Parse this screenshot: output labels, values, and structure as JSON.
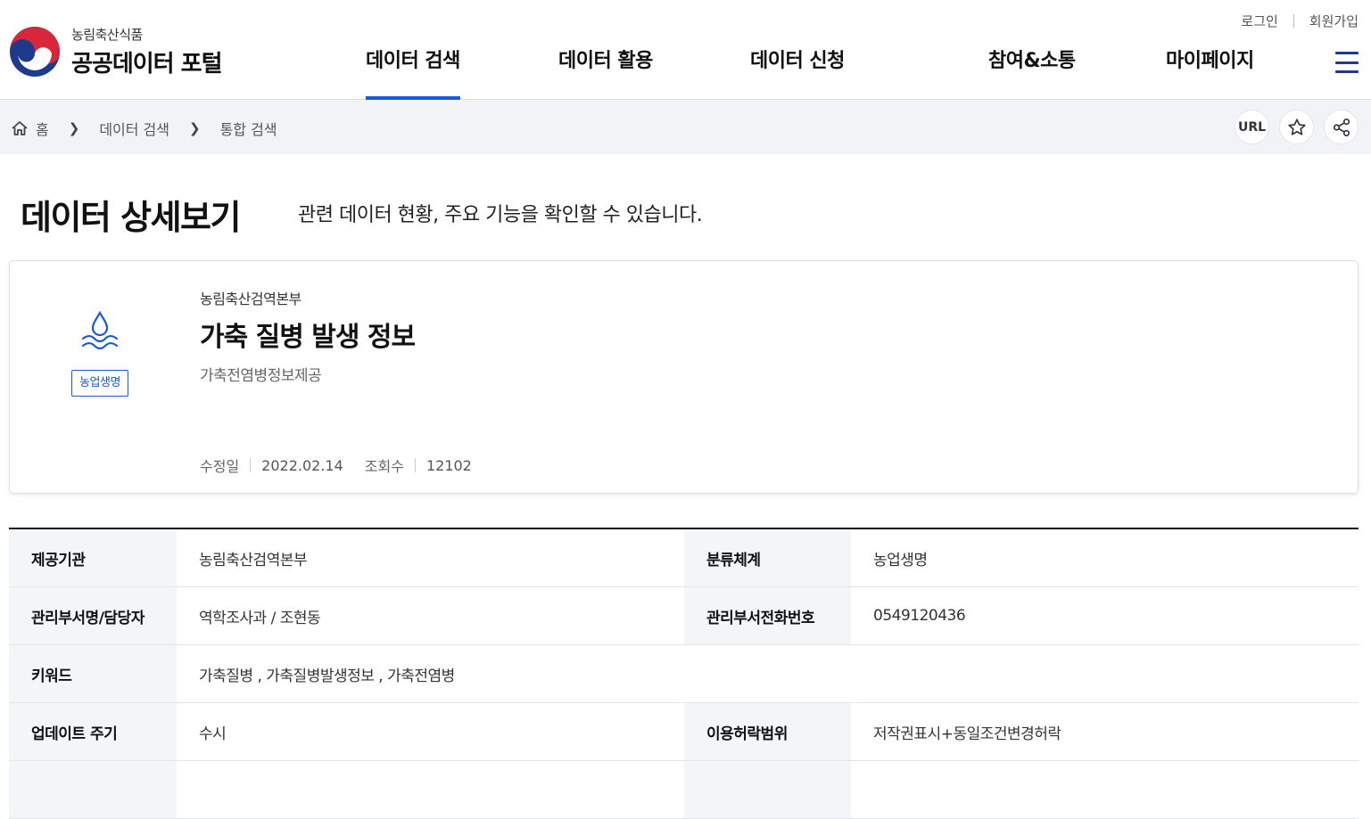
{
  "header": {
    "logo_sub": "농림축산식품",
    "logo_main": "공공데이터 포털",
    "util": {
      "login": "로그인",
      "signup": "회원가입"
    },
    "nav": [
      {
        "label": "데이터 검색",
        "active": true
      },
      {
        "label": "데이터 활용",
        "active": false
      },
      {
        "label": "데이터 신청",
        "active": false
      },
      {
        "label": "참여&소통",
        "active": false
      },
      {
        "label": "마이페이지",
        "active": false
      }
    ],
    "menu_icon": "hamburger-icon"
  },
  "breadcrumb": {
    "items": [
      "홈",
      "데이터 검색",
      "통합 검색"
    ],
    "tools": {
      "url_label": "URL",
      "favorite_icon": "star-icon",
      "share_icon": "share-icon"
    }
  },
  "page": {
    "title": "데이터 상세보기",
    "description": "관련 데이터 현황, 주요 기능을 확인할 수 있습니다."
  },
  "card": {
    "icon": "water-drop-icon",
    "category_tag": "농업생명",
    "org": "농림축산검역본부",
    "title": "가축 질병 발생 정보",
    "subtitle": "가축전염병정보제공",
    "modified_label": "수정일",
    "modified_value": "2022.02.14",
    "views_label": "조회수",
    "views_value": "12102"
  },
  "info_table": {
    "rows": [
      {
        "h1": "제공기관",
        "v1": "농림축산검역본부",
        "h2": "분류체계",
        "v2": "농업생명"
      },
      {
        "h1": "관리부서명/담당자",
        "v1": "역학조사과 /  조현동",
        "h2": "관리부서전화번호",
        "v2": "0549120436"
      },
      {
        "h1": "키워드",
        "v1": "가축질병 , 가축질병발생정보 , 가축전염병"
      },
      {
        "h1": "업데이트 주기",
        "v1": "수시",
        "h2": "이용허락범위",
        "v2": "저작권표시+동일조건변경허락"
      }
    ]
  },
  "colors": {
    "accent": "#1a5ad7",
    "navy": "#1d3a8c",
    "crumb_bg": "#f1f3f6",
    "th_bg": "#f4f5f7"
  }
}
